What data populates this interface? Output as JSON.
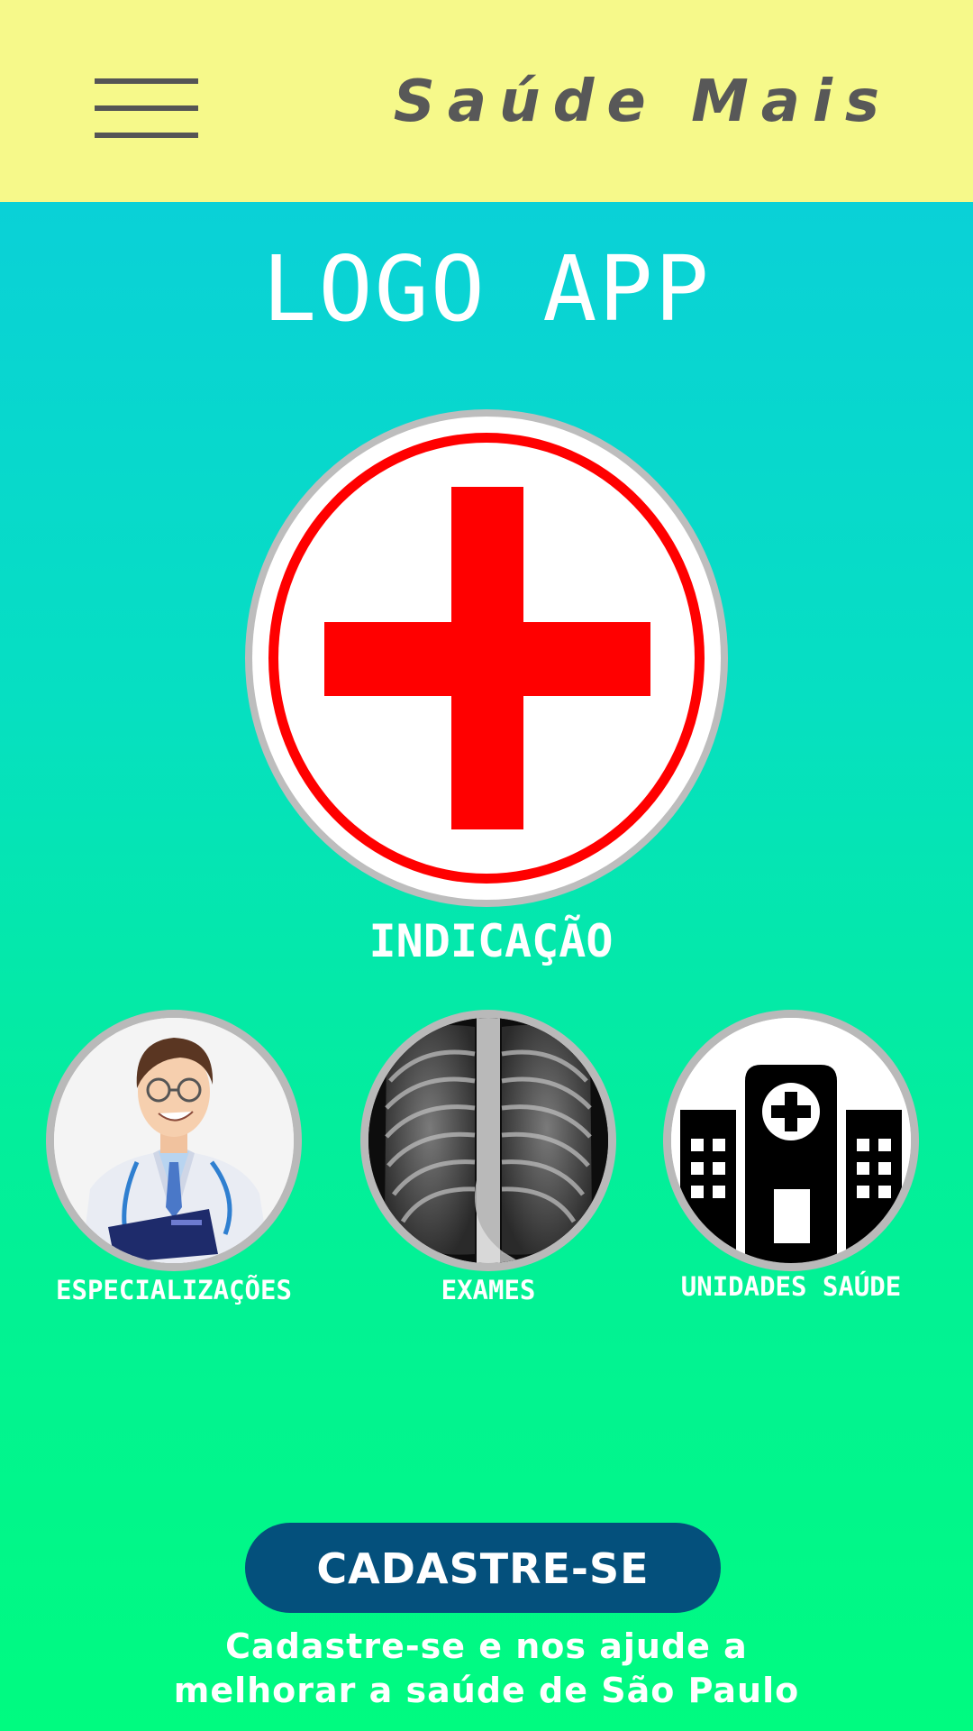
{
  "header": {
    "menu_icon": "hamburger-menu-icon",
    "title": "Saúde Mais",
    "background": "#f6f98a"
  },
  "logo": {
    "text": "LOGO APP"
  },
  "main_feature": {
    "icon": "red-cross-icon",
    "label": "INDICAÇÃO",
    "cross_color": "#ff0000"
  },
  "categories": [
    {
      "icon": "doctor-icon",
      "label": "ESPECIALIZAÇÕES"
    },
    {
      "icon": "chest-xray-icon",
      "label": "EXAMES"
    },
    {
      "icon": "hospital-building-icon",
      "label": "UNIDADES SAÚDE"
    }
  ],
  "cta": {
    "button_label": "CADASTRE-SE",
    "description_line1": "Cadastre-se e nos ajude a",
    "description_line2": "melhorar a saúde de São Paulo",
    "button_color": "#04507c"
  },
  "colors": {
    "gradient_top": "#0ccbe0",
    "gradient_bottom": "#00fb80"
  }
}
